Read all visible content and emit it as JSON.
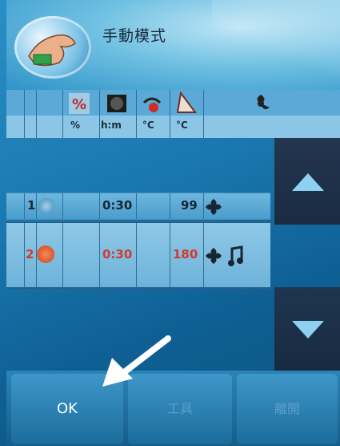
{
  "header": {
    "title": "手動模式"
  },
  "columns": {
    "units": [
      "%",
      "h:m",
      "°C",
      "°C"
    ],
    "icons": [
      "percent-icon",
      "timer-icon",
      "thermometer-icon",
      "probe-icon",
      "fan-icon"
    ]
  },
  "rows": [
    {
      "index": "1",
      "time": "0:30",
      "temp": "99",
      "highlight": false
    },
    {
      "index": "2",
      "time": "0:30",
      "temp": "180",
      "highlight": true
    }
  ],
  "footer": {
    "ok": "OK",
    "tools": "工具",
    "leave": "離開"
  },
  "colors": {
    "row2_text": "#d23a2e",
    "scroll_bg": "#233a55",
    "accent": "#e05a2a"
  }
}
